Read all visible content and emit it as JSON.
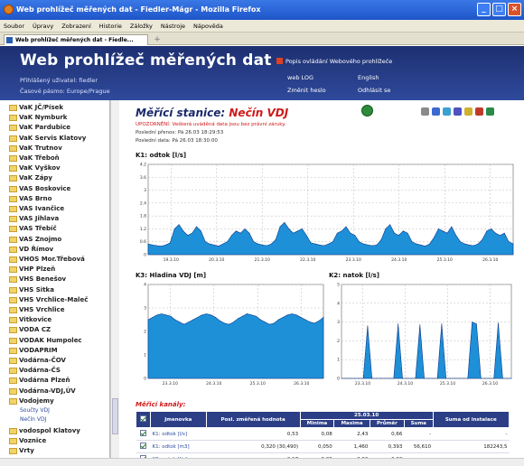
{
  "window": {
    "title": "Web prohlížeč měřených dat - Fiedler-Mágr - Mozilla Firefox",
    "tab_title": "Web prohlížeč měřených dat - Fiedle..."
  },
  "menu": [
    "Soubor",
    "Úpravy",
    "Zobrazení",
    "Historie",
    "Záložky",
    "Nástroje",
    "Nápověda"
  ],
  "header": {
    "app_title": "Web prohlížeč měřených dat",
    "user_line": "Přihlášený uživatel: fiedler",
    "tz_line": "Časové pásmo: Europe/Prague",
    "links": {
      "manual": "Popis ovládání Webového prohlížeče",
      "weblog": "web LOG",
      "english": "English",
      "change_password": "Změnit heslo",
      "logout": "Odhlásit se"
    }
  },
  "sidebar": {
    "items": [
      "VaK JČ/Písek",
      "VaK Nymburk",
      "VaK Pardubice",
      "VaK Servis Klatovy",
      "VaK Trutnov",
      "VaK Třeboň",
      "VaK Vyškov",
      "VaK Zápy",
      "VAS Boskovice",
      "VAS Brno",
      "VAS Ivančice",
      "VAS Jihlava",
      "VAS Třebíč",
      "VAS Znojmo",
      "VD Římov",
      "VHOS Mor.Třebová",
      "VHP Plzeň",
      "VHS Benešov",
      "VHS Sitka",
      "VHS Vrchlice-Maleč",
      "VHS Vrchlice",
      "Vitkovice",
      "VODA CZ",
      "VODAK Humpolec",
      "VODAPRIM",
      "Vodárna-ČOV",
      "Vodárna-ČS",
      "Vodárna Plzeň",
      "Vodárna-VDJ,ÚV",
      "Vodojemy"
    ],
    "subitems": [
      "Součty VDJ",
      "Nečín VDJ"
    ],
    "items_after": [
      "vodospol Klatovy",
      "Voznice",
      "Vrty"
    ]
  },
  "station": {
    "title_prefix": "Měřící stanice:",
    "name": "Nečín VDJ",
    "warning": "UPOZORNĚNÍ: Veškerá uváděná data jsou bez právní záruky.",
    "last_transfer": "Poslední přenos:   Pá 26.03 18:29:53",
    "last_data": "Poslední data:     Pá 26.03 18:30:00"
  },
  "chart_data": [
    {
      "type": "area",
      "title": "K1: odtok [l/s]",
      "categories": [
        "19.3.10",
        "20.3.10",
        "21.3.10",
        "22.3.10",
        "23.3.10",
        "24.3.10",
        "25.3.10",
        "26.3.10"
      ],
      "yticks": [
        0.0,
        0.6,
        1.2,
        1.8,
        2.4,
        3.0,
        3.6,
        4.2
      ],
      "ylim": [
        0,
        4.2
      ],
      "series": [
        {
          "values": [
            0.5,
            0.45,
            0.42,
            0.4,
            0.45,
            0.55,
            1.2,
            1.4,
            1.1,
            0.9,
            1.0,
            1.3,
            1.1,
            0.6,
            0.5,
            0.45,
            0.4,
            0.5,
            0.6,
            0.9,
            1.1,
            1.0,
            1.2,
            1.0,
            0.6,
            0.5,
            0.45,
            0.42,
            0.5,
            0.7,
            1.3,
            1.5,
            1.2,
            1.0,
            1.1,
            1.2,
            0.9,
            0.55,
            0.5,
            0.45,
            0.42,
            0.5,
            0.6,
            1.0,
            1.1,
            1.3,
            1.0,
            0.9,
            0.6,
            0.5,
            0.45,
            0.42,
            0.45,
            0.7,
            1.2,
            1.4,
            1.0,
            0.9,
            1.1,
            1.0,
            0.6,
            0.5,
            0.45,
            0.4,
            0.5,
            0.8,
            1.2,
            1.1,
            1.0,
            1.3,
            0.9,
            0.6,
            0.5,
            0.45,
            0.42,
            0.5,
            0.7,
            1.1,
            1.2,
            1.0,
            0.9,
            1.0,
            0.6,
            0.5
          ]
        }
      ]
    },
    {
      "type": "area",
      "title": "K3: Hladina VDJ [m]",
      "categories": [
        "23.3.10",
        "24.3.10",
        "25.3.10",
        "26.3.10"
      ],
      "yticks": [
        0,
        1,
        2,
        3,
        4
      ],
      "ylim": [
        0,
        4
      ],
      "series": [
        {
          "values": [
            2.5,
            2.6,
            2.7,
            2.75,
            2.7,
            2.65,
            2.5,
            2.4,
            2.3,
            2.4,
            2.5,
            2.6,
            2.7,
            2.75,
            2.7,
            2.6,
            2.45,
            2.35,
            2.3,
            2.4,
            2.55,
            2.65,
            2.75,
            2.7,
            2.65,
            2.5,
            2.4,
            2.3,
            2.35,
            2.5,
            2.6,
            2.7,
            2.75,
            2.7,
            2.6,
            2.5,
            2.4,
            2.35,
            2.45,
            2.6
          ]
        }
      ]
    },
    {
      "type": "area",
      "title": "K2: natok [l/s]",
      "categories": [
        "23.3.10",
        "24.3.10",
        "25.3.10",
        "26.3.10"
      ],
      "yticks": [
        0.0,
        1.0,
        2.0,
        3.0,
        4.0,
        5.0
      ],
      "ylim": [
        0,
        5.0
      ],
      "series": [
        {
          "values": [
            0,
            0,
            0,
            0,
            0,
            0,
            2.8,
            0,
            0,
            0,
            0,
            0,
            0,
            2.9,
            0,
            0,
            0,
            0,
            2.85,
            0,
            0,
            0,
            0,
            2.9,
            0,
            0,
            0,
            0,
            0,
            0,
            3.0,
            2.9,
            0,
            0,
            0,
            0,
            2.95,
            0,
            0,
            0
          ]
        }
      ]
    }
  ],
  "channels": {
    "title": "Měřicí kanály:",
    "headers": {
      "name": "Jmenovka",
      "last_value": "Posl. změřená hodnota",
      "date": "25.03.10",
      "min": "Minima",
      "max": "Maxima",
      "avg": "Průměr",
      "sum": "Suma",
      "sum_since": "Suma od instalace"
    },
    "rows": [
      {
        "name": "K1: odtok [l/s]",
        "last": "0,53",
        "min": "0,08",
        "max": "2,43",
        "avg": "0,66",
        "sum": "-",
        "total": "-"
      },
      {
        "name": "K1: odtok [m3]",
        "last": "0,320 (30,490)",
        "min": "0,050",
        "max": "1,460",
        "avg": "0,393",
        "sum": "56,610",
        "total": "182243,5"
      },
      {
        "name": "K2: natok [l/s]",
        "last": "0,17",
        "min": "0,02",
        "max": "2,92",
        "avg": "0,63",
        "sum": "-",
        "total": "-"
      }
    ]
  },
  "colors": {
    "fill": "#1e90d8",
    "stroke": "#0a3a8a",
    "header": "#1d2f70",
    "accent": "#d01818"
  }
}
